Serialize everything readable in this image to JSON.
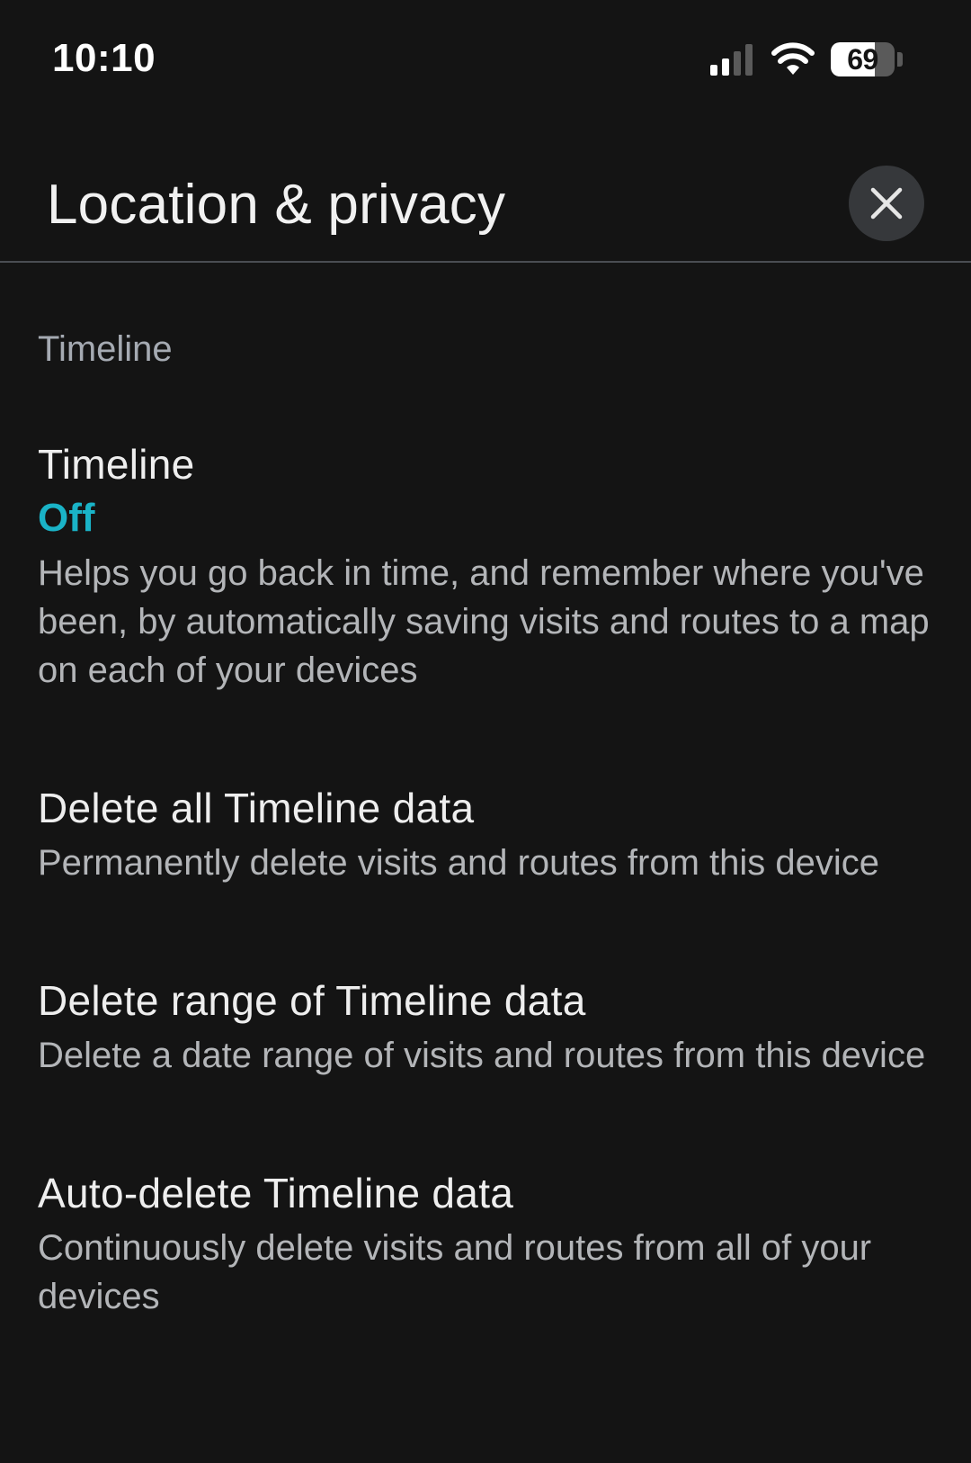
{
  "status_bar": {
    "time": "10:10",
    "battery_percent": "69",
    "battery_level": 0.69,
    "signal_icon": "cellular-signal-icon",
    "wifi_icon": "wifi-icon"
  },
  "header": {
    "title": "Location & privacy",
    "close_icon": "close-icon"
  },
  "section": {
    "title": "Timeline"
  },
  "settings": [
    {
      "title": "Timeline",
      "status": "Off",
      "description": "Helps you go back in time, and remember where you've been, by automatically saving visits and routes to a map on each of your devices"
    },
    {
      "title": "Delete all Timeline data",
      "description": "Permanently delete visits and routes from this device"
    },
    {
      "title": "Delete range of Timeline data",
      "description": "Delete a date range of visits and routes from this device"
    },
    {
      "title": "Auto-delete Timeline data",
      "description": "Continuously delete visits and routes from all of your devices"
    }
  ],
  "colors": {
    "background": "#141414",
    "accent": "#1ab3c7",
    "secondary_text": "#b3b5b8",
    "section_header": "#a5aab2"
  }
}
